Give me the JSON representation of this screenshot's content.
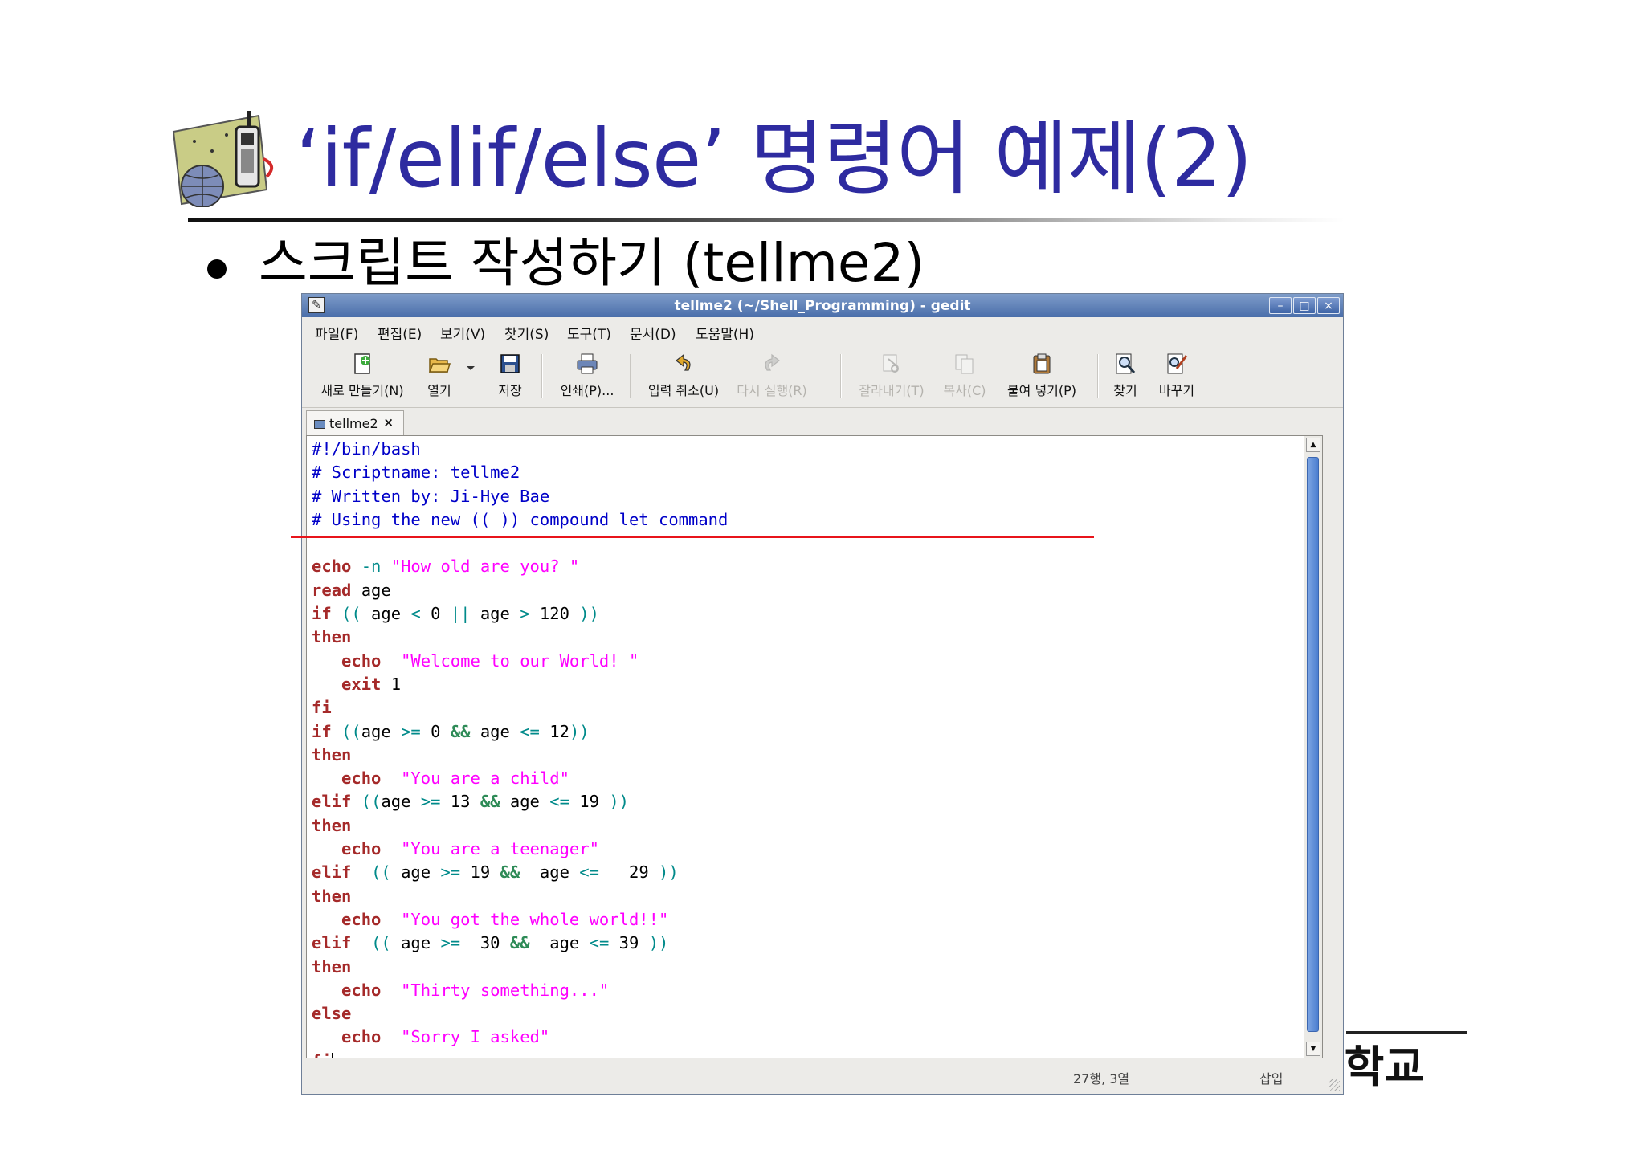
{
  "slide": {
    "title": "‘if/elif/else’ 명령어 예제(2)",
    "bullet": "스크립트 작성하기 (tellme2)",
    "university_fragment": "대학교"
  },
  "window": {
    "title": "tellme2 (~/Shell_Programming) - gedit",
    "controls": {
      "minimize": "–",
      "maximize": "□",
      "close": "×"
    }
  },
  "menu": [
    "파일(F)",
    "편집(E)",
    "보기(V)",
    "찾기(S)",
    "도구(T)",
    "문서(D)",
    "도움말(H)"
  ],
  "toolbar": {
    "new": "새로 만들기(N)",
    "open": "열기",
    "save": "저장",
    "print": "인쇄(P)...",
    "undo": "입력 취소(U)",
    "redo": "다시 실행(R)",
    "cut": "잘라내기(T)",
    "copy": "복사(C)",
    "paste": "붙여 넣기(P)",
    "find": "찾기",
    "replace": "바꾸기"
  },
  "tab": {
    "label": "tellme2",
    "close": "×"
  },
  "code_lines": [
    "#!/bin/bash",
    "# Scriptname: tellme2",
    "# Written by: Ji-Hye Bae",
    "# Using the new (( )) compound let command",
    "",
    "echo -n \"How old are you? \"",
    "read age",
    "if (( age < 0 || age > 120 ))",
    "then",
    "   echo  \"Welcome to our World! \"",
    "   exit 1",
    "fi",
    "if ((age >= 0 && age <= 12))",
    "then",
    "   echo  \"You are a child\"",
    "elif ((age >= 13 && age <= 19 ))",
    "then",
    "   echo  \"You are a teenager\"",
    "elif  (( age >= 19 &&  age <=   29 ))",
    "then",
    "   echo  \"You got the whole world!!\"",
    "elif  (( age >=  30 &&  age <= 39 ))",
    "then",
    "   echo  \"Thirty something...\"",
    "else",
    "   echo  \"Sorry I asked\"",
    "fi"
  ],
  "status": {
    "position": "27행, 3열",
    "mode": "삽입"
  }
}
